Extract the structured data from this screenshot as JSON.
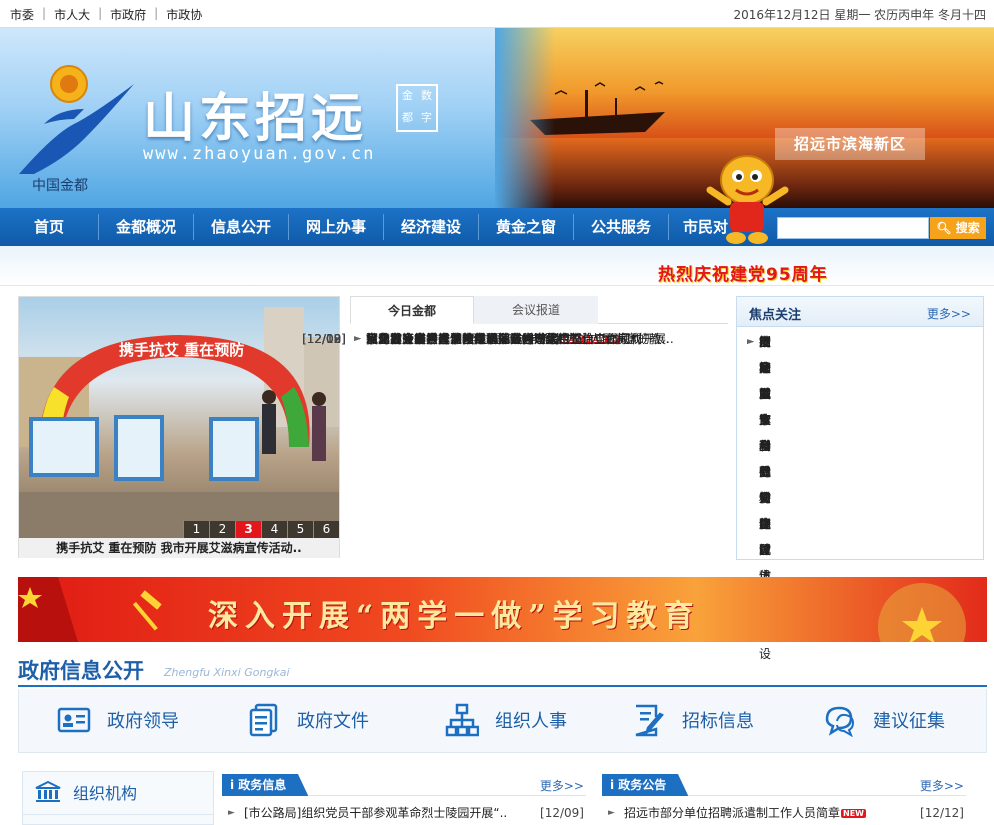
{
  "topbar": {
    "links": [
      "市委",
      "市人大",
      "市政府",
      "市政协"
    ],
    "date": "2016年12月12日 星期一 农历丙申年 冬月十四"
  },
  "banner": {
    "title": "山东招远",
    "url": "www.zhaoyuan.gov.cn",
    "seal_chars": [
      "金",
      "数",
      "都",
      "字"
    ],
    "area_label": "招远市滨海新区"
  },
  "nav": {
    "items": [
      "首页",
      "金都概况",
      "信息公开",
      "网上办事",
      "经济建设",
      "黄金之窗",
      "公共服务",
      "市民对"
    ],
    "search_placeholder": "",
    "search_label": "搜索"
  },
  "slogan": "热烈庆祝建党95周年",
  "slideshow": {
    "arch_text": "携手抗艾  重在预防",
    "caption": "携手抗艾 重在预防 我市开展艾滋病宣传活动..",
    "pages": [
      "1",
      "2",
      "3",
      "4",
      "5",
      "6"
    ],
    "active_page": "3"
  },
  "news": {
    "tabs": [
      "今日金都",
      "会议报道"
    ],
    "items": [
      {
        "title": "市总工会心系企业困难职工开展送温暖活动",
        "is_new": true,
        "date": "[12/12]"
      },
      {
        "title": "就业办三举措推进社保卡业务常态化",
        "is_new": true,
        "date": "[12/12]"
      },
      {
        "title": "市场监管局开展岁末年初安全生产大检查",
        "is_new": true,
        "date": "[12/12]"
      },
      {
        "title": "辛庄后康家用光伏发电用掉贫困“帽子”",
        "is_new": false,
        "date": "[12/09]"
      },
      {
        "title": "招远市义务教育学校校长职级评审认定工作全面完成",
        "is_new": false,
        "date": "[12/09]"
      },
      {
        "title": "水务局多措并举保障冬季河道采砂综合整治工作顺利开展..",
        "is_new": false,
        "date": "[12/09]"
      },
      {
        "title": "深化教育教学改革 努力提高办学条件 办让人民满意的教..",
        "is_new": false,
        "date": "[12/08]"
      },
      {
        "title": "市交警开展冬季酒驾交通违法行为集中整治",
        "is_new": false,
        "date": "[12/08]"
      },
      {
        "title": "夏甸镇大走访真切倾听百姓心声",
        "is_new": false,
        "date": "[12/08]"
      }
    ],
    "new_label": "NEW"
  },
  "focus": {
    "title": "焦点关注",
    "more": "更多>>",
    "items": [
      "国家政策",
      "创建国家食品安全城市",
      "食品安全科普知识",
      "市场主体登记信息",
      "社会主义新农村建设",
      "培植重点产业和园区",
      "招商引资和对外经贸",
      "抓好城市基础设施建设",
      "加大就业和社会保障体系建设"
    ]
  },
  "party_banner": "深入开展“两学一做”学习教育",
  "gov": {
    "title": "政府信息公开",
    "subtitle": "Zhengfu Xinxi Gongkai",
    "tabs": [
      "政府领导",
      "政府文件",
      "组织人事",
      "招标信息",
      "建议征集"
    ],
    "sidebox_label": "组织机构"
  },
  "columns": [
    {
      "tag": "政务信息",
      "more": "更多>>",
      "item": {
        "title": "[市公路局]组织党员干部参观革命烈士陵园开展“..",
        "is_new": false,
        "date": "[12/09]"
      }
    },
    {
      "tag": "政务公告",
      "more": "更多>>",
      "item": {
        "title": "招远市部分单位招聘派遣制工作人员简章",
        "is_new": true,
        "date": "[12/12]"
      }
    }
  ],
  "colors": {
    "nav_blue": "#1d72c7",
    "accent_red": "#e3171b",
    "search_orange": "#f7a21b"
  }
}
